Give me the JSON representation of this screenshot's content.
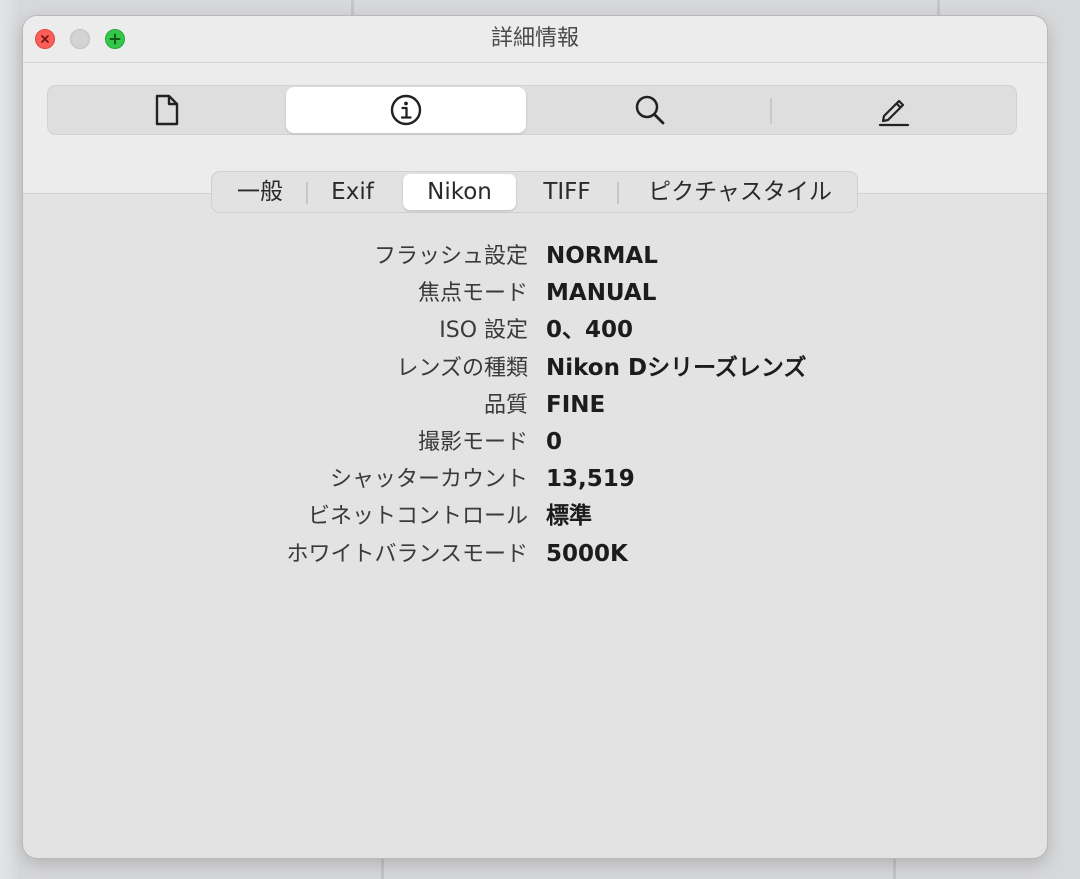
{
  "window": {
    "title": "詳細情報"
  },
  "colors": {
    "close": "#fc5f57",
    "minimize": "#d3d3d3",
    "zoom": "#34c749",
    "window_bg": "#e3e3e3",
    "active_segment": "#ffffff"
  },
  "toolbar": {
    "buttons": [
      {
        "icon": "document-icon",
        "active": false
      },
      {
        "icon": "info-icon",
        "active": true
      },
      {
        "icon": "search-icon",
        "active": false
      },
      {
        "icon": "pencil-icon",
        "active": false
      }
    ]
  },
  "tabs": [
    {
      "label": "一般",
      "active": false
    },
    {
      "label": "Exif",
      "active": false
    },
    {
      "label": "Nikon",
      "active": true
    },
    {
      "label": "TIFF",
      "active": false
    },
    {
      "label": "ピクチャスタイル",
      "active": false
    }
  ],
  "info": [
    {
      "label": "フラッシュ設定",
      "value": "NORMAL"
    },
    {
      "label": "焦点モード",
      "value": "MANUAL"
    },
    {
      "label": "ISO 設定",
      "value": "0、400"
    },
    {
      "label": "レンズの種類",
      "value": "Nikon Dシリーズレンズ"
    },
    {
      "label": "品質",
      "value": "FINE"
    },
    {
      "label": "撮影モード",
      "value": "0"
    },
    {
      "label": "シャッターカウント",
      "value": "13,519"
    },
    {
      "label": "ビネットコントロール",
      "value": "標準"
    },
    {
      "label": "ホワイトバランスモード",
      "value": "5000K"
    }
  ]
}
